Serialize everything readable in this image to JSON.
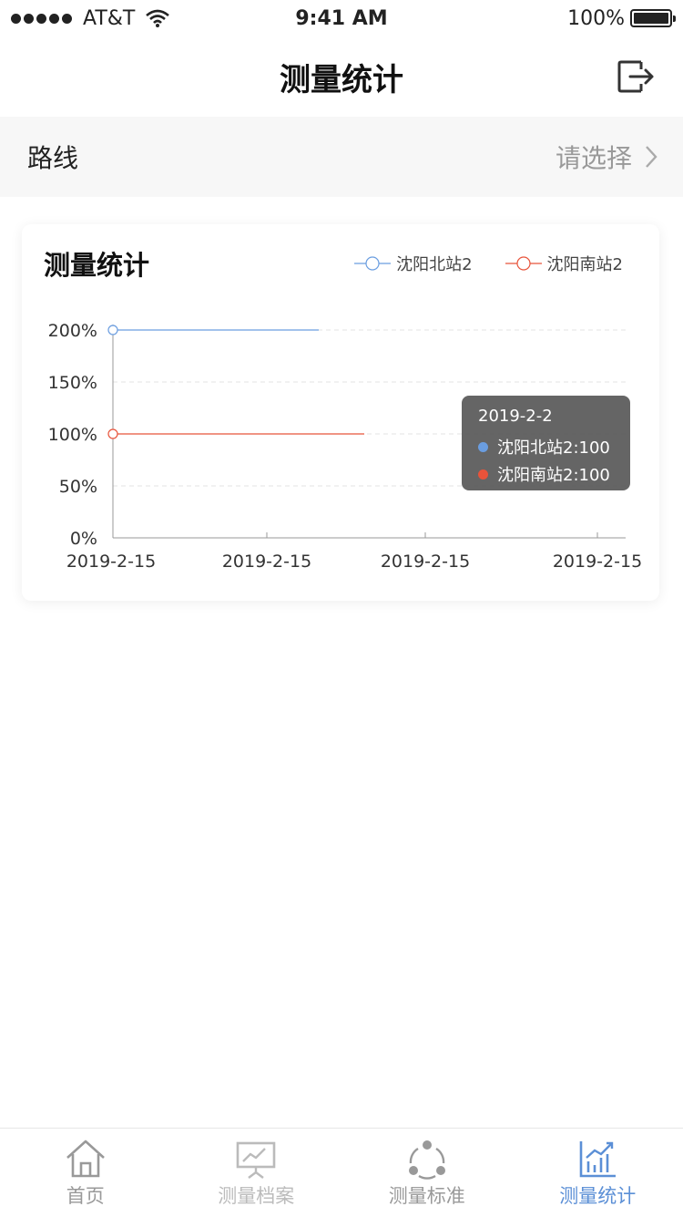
{
  "status_bar": {
    "carrier": "AT&T",
    "time": "9:41 AM",
    "battery": "100%",
    "battery_level": 1.0
  },
  "nav": {
    "title": "测量统计",
    "right_icon": "logout-icon"
  },
  "route": {
    "label": "路线",
    "value": "请选择",
    "chevron_icon": "chevron-right-icon"
  },
  "card": {
    "title": "测量统计"
  },
  "tooltip": {
    "date": "2019-2-2",
    "rows": [
      {
        "text": "沈阳北站2:100",
        "color": "#6a9de0"
      },
      {
        "text": "沈阳南站2:100",
        "color": "#e8533a"
      }
    ]
  },
  "chart_data": {
    "type": "line",
    "title": "测量统计",
    "categories": [
      "2019-2-15",
      "2019-2-15",
      "2019-2-15",
      "2019-2-15"
    ],
    "series": [
      {
        "name": "沈阳北站2",
        "color": "#6a9de0",
        "values": [
          200,
          200
        ]
      },
      {
        "name": "沈阳南站2",
        "color": "#e8533a",
        "values": [
          100,
          100
        ]
      }
    ],
    "ylim": [
      0,
      200
    ],
    "y_ticks": [
      "0%",
      "50%",
      "100%",
      "150%",
      "200%"
    ],
    "legend": "top-right",
    "grid": true
  },
  "tabs": [
    {
      "label": "首页",
      "icon": "home-icon",
      "state": "normal"
    },
    {
      "label": "测量档案",
      "icon": "presentation-chart-icon",
      "state": "faded"
    },
    {
      "label": "测量标准",
      "icon": "share-nodes-icon",
      "state": "normal"
    },
    {
      "label": "测量统计",
      "icon": "bar-chart-icon",
      "state": "active"
    }
  ]
}
